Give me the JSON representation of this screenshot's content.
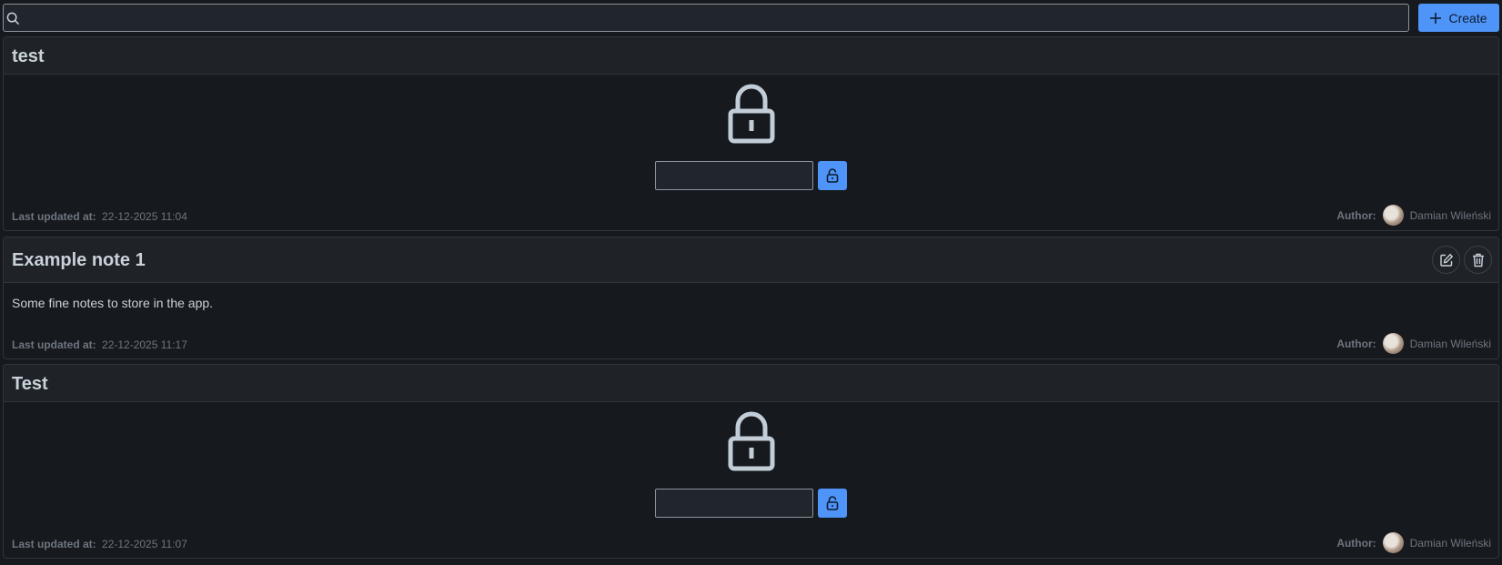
{
  "toolbar": {
    "search_value": "",
    "create_label": "Create"
  },
  "notes": [
    {
      "title": "test",
      "locked": true,
      "password_value": "",
      "updated_label": "Last updated at:",
      "updated_value": "22-12-2025 11:04",
      "author_label": "Author:",
      "author_name": "Damian Wileński"
    },
    {
      "title": "Example note 1",
      "locked": false,
      "content": "Some fine notes to store in the app.",
      "updated_label": "Last updated at:",
      "updated_value": "22-12-2025 11:17",
      "author_label": "Author:",
      "author_name": "Damian Wileński"
    },
    {
      "title": "Test",
      "locked": true,
      "password_value": "",
      "updated_label": "Last updated at:",
      "updated_value": "22-12-2025 11:07",
      "author_label": "Author:",
      "author_name": "Damian Wileński"
    }
  ],
  "colors": {
    "accent": "#4f94f9",
    "background": "#16191d",
    "header": "#1f2328",
    "border": "#30363d"
  }
}
